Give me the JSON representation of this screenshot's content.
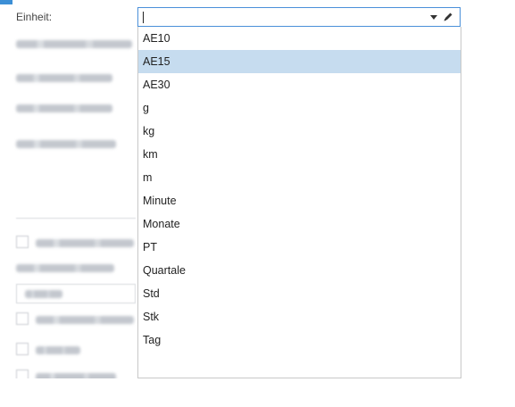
{
  "form": {
    "unit_label": "Einheit:",
    "unit_input_value": ""
  },
  "dropdown": {
    "options": [
      "AE10",
      "AE15",
      "AE30",
      "g",
      "kg",
      "km",
      "m",
      "Minute",
      "Monate",
      "PT",
      "Quartale",
      "Std",
      "Stk",
      "Tag"
    ],
    "selected": "AE15"
  },
  "colors": {
    "accent": "#3c8fd6",
    "selection": "#c6dcef",
    "focus_border": "#4a90d9"
  },
  "icons": [
    "chevron-down-icon",
    "pencil-icon"
  ]
}
